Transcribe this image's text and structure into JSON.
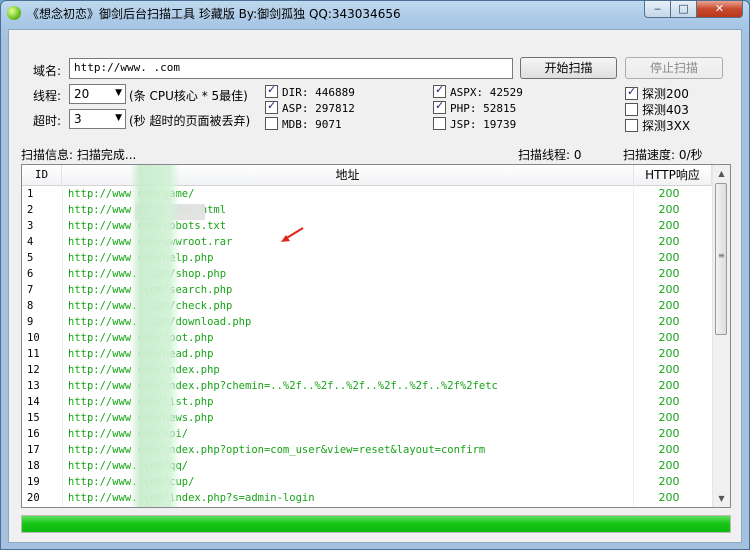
{
  "window": {
    "title": "《想念初恋》御剑后台扫描工具 珍藏版 By:御剑孤独 QQ:343034656"
  },
  "window_controls": {
    "minimize": "‒",
    "maximize": "□",
    "close": "✕"
  },
  "form": {
    "domain_label": "域名:",
    "domain_value": "http://www.        .com",
    "threads_label": "线程:",
    "threads_value": "20",
    "threads_hint": "(条 CPU核心 * 5最佳)",
    "timeout_label": "超时:",
    "timeout_value": "3",
    "timeout_hint": "(秒 超时的页面被丢弃)",
    "start_button": "开始扫描",
    "stop_button": "停止扫描"
  },
  "dictionaries": [
    {
      "name": "DIR",
      "count": "446889",
      "checked": true
    },
    {
      "name": "ASP",
      "count": "297812",
      "checked": true
    },
    {
      "name": "MDB",
      "count": "9071",
      "checked": false
    },
    {
      "name": "ASPX",
      "count": "42529",
      "checked": true
    },
    {
      "name": "PHP",
      "count": "52815",
      "checked": true
    },
    {
      "name": "JSP",
      "count": "19739",
      "checked": false
    }
  ],
  "detect_options": [
    {
      "label": "探测200",
      "checked": true
    },
    {
      "label": "探测403",
      "checked": false
    },
    {
      "label": "探测3XX",
      "checked": false
    }
  ],
  "status": {
    "info_label": "扫描信息:",
    "info_value": "扫描完成...",
    "threads_label": "扫描线程:",
    "threads_value": "0",
    "speed_label": "扫描速度:",
    "speed_value": "0/秒"
  },
  "table": {
    "columns": [
      "ID",
      "地址",
      "HTTP响应"
    ],
    "rows": [
      {
        "id": "1",
        "url": "http://www        com/game/",
        "code": "200"
      },
      {
        "id": "2",
        "url": "http://www        com/index.html",
        "code": "200"
      },
      {
        "id": "3",
        "url": "http://www        com/robots.txt",
        "code": "200"
      },
      {
        "id": "4",
        "url": "http://www        com/wwwroot.rar",
        "code": "200"
      },
      {
        "id": "5",
        "url": "http://www        com/help.php",
        "code": "200"
      },
      {
        "id": "6",
        "url": "http://www.       .com/shop.php",
        "code": "200"
      },
      {
        "id": "7",
        "url": "http://www        .com/search.php",
        "code": "200"
      },
      {
        "id": "8",
        "url": "http://www.       .com/check.php",
        "code": "200"
      },
      {
        "id": "9",
        "url": "http://www.       .com/download.php",
        "code": "200"
      },
      {
        "id": "10",
        "url": "http://www        com/foot.php",
        "code": "200"
      },
      {
        "id": "11",
        "url": "http://www        com/head.php",
        "code": "200"
      },
      {
        "id": "12",
        "url": "http://www        com/index.php",
        "code": "200"
      },
      {
        "id": "13",
        "url": "http://www        com/index.php?chemin=..%2f..%2f..%2f..%2f..%2f..%2f%2fetc",
        "code": "200"
      },
      {
        "id": "14",
        "url": "http://www        com/list.php",
        "code": "200"
      },
      {
        "id": "15",
        "url": "http://www        com/news.php",
        "code": "200"
      },
      {
        "id": "16",
        "url": "http://www        com/api/",
        "code": "200"
      },
      {
        "id": "17",
        "url": "http://www        com/index.php?option=com_user&view=reset&layout=confirm",
        "code": "200"
      },
      {
        "id": "18",
        "url": "http://www.       com/qq/",
        "code": "200"
      },
      {
        "id": "19",
        "url": "http://www.       com/cup/",
        "code": "200"
      },
      {
        "id": "20",
        "url": "http://www.       com/index.php?s=admin-login",
        "code": "200"
      }
    ]
  },
  "progress": {
    "value_percent": 100
  },
  "colors": {
    "url_green": "#17a317",
    "progress_green": "#14c414",
    "arrow_red": "#e0241b"
  },
  "icons": {
    "app": "green-ball-icon",
    "annotation": "red-arrow-icon"
  }
}
